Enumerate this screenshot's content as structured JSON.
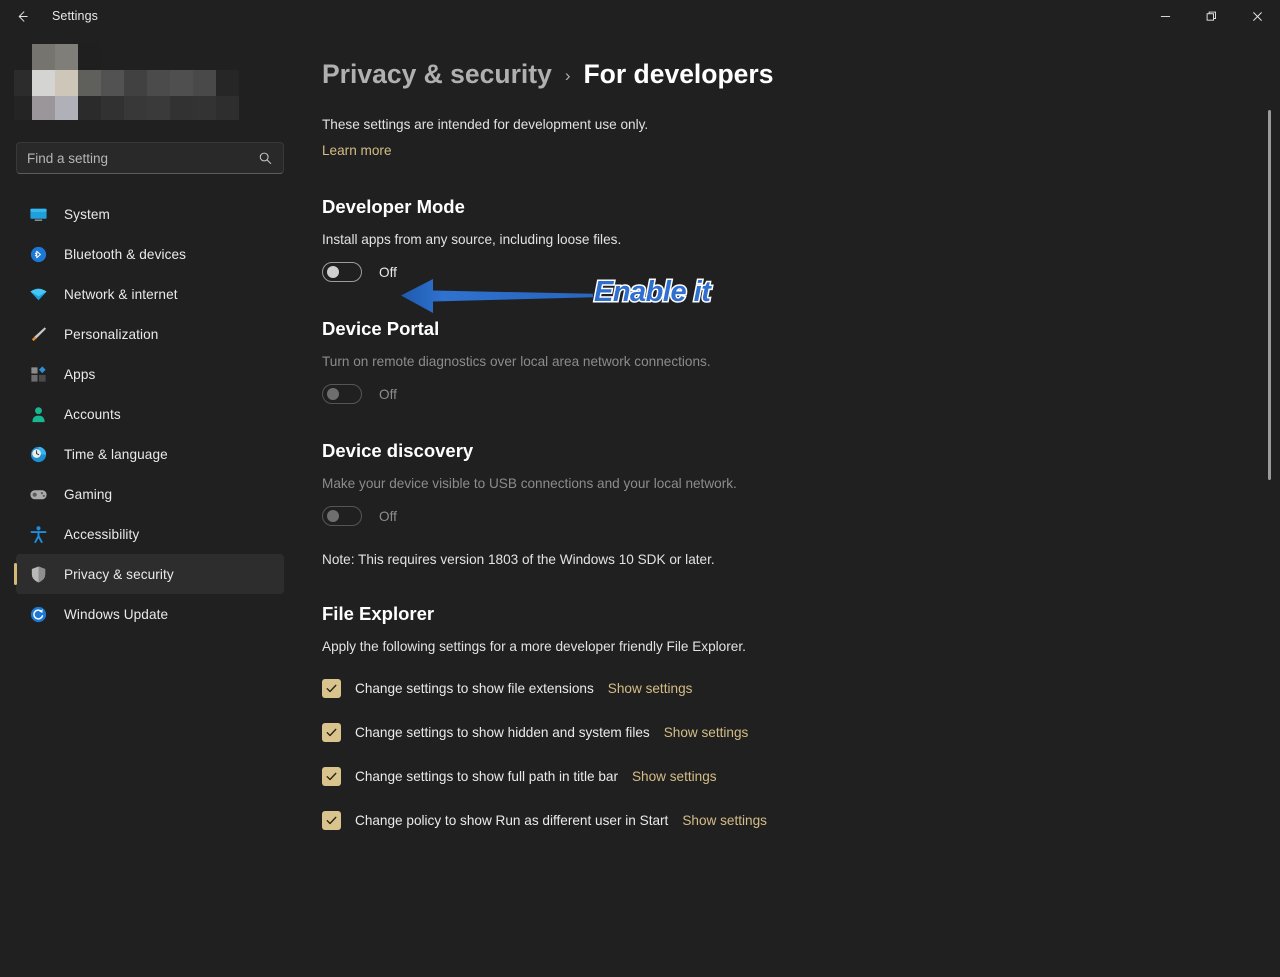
{
  "window": {
    "app_title": "Settings",
    "back_icon": "back-arrow-icon",
    "controls": {
      "minimize": "minimize-icon",
      "maximize": "restore-icon",
      "close": "close-icon"
    }
  },
  "sidebar": {
    "profile": {
      "redacted": true,
      "description": "pixelated user account name and email"
    },
    "search": {
      "placeholder": "Find a setting",
      "value": "",
      "icon": "search-icon"
    },
    "items": [
      {
        "label": "System",
        "icon": "monitor-icon",
        "selected": false
      },
      {
        "label": "Bluetooth & devices",
        "icon": "bluetooth-icon",
        "selected": false
      },
      {
        "label": "Network & internet",
        "icon": "wifi-icon",
        "selected": false
      },
      {
        "label": "Personalization",
        "icon": "paintbrush-icon",
        "selected": false
      },
      {
        "label": "Apps",
        "icon": "apps-icon",
        "selected": false
      },
      {
        "label": "Accounts",
        "icon": "person-icon",
        "selected": false
      },
      {
        "label": "Time & language",
        "icon": "clock-icon",
        "selected": false
      },
      {
        "label": "Gaming",
        "icon": "gamepad-icon",
        "selected": false
      },
      {
        "label": "Accessibility",
        "icon": "accessibility-icon",
        "selected": false
      },
      {
        "label": "Privacy & security",
        "icon": "shield-icon",
        "selected": true
      },
      {
        "label": "Windows Update",
        "icon": "update-icon",
        "selected": false
      }
    ]
  },
  "main": {
    "breadcrumb": {
      "parent": "Privacy & security",
      "separator": "›",
      "current": "For developers"
    },
    "intro": "These settings are intended for development use only.",
    "learn_more": "Learn more",
    "developer_mode": {
      "title": "Developer Mode",
      "description": "Install apps from any source, including loose files.",
      "toggle_state": "Off",
      "enabled": true
    },
    "device_portal": {
      "title": "Device Portal",
      "description": "Turn on remote diagnostics over local area network connections.",
      "toggle_state": "Off",
      "enabled": false
    },
    "device_discovery": {
      "title": "Device discovery",
      "description": "Make your device visible to USB connections and your local network.",
      "toggle_state": "Off",
      "enabled": false,
      "note": "Note: This requires version 1803 of the Windows 10 SDK or later."
    },
    "file_explorer": {
      "title": "File Explorer",
      "description": "Apply the following settings for a more developer friendly File Explorer.",
      "link_label": "Show settings",
      "rows": [
        {
          "label": "Change settings to show file extensions",
          "checked": true,
          "link": "Show settings"
        },
        {
          "label": "Change settings to show hidden and system files",
          "checked": true,
          "link": "Show settings"
        },
        {
          "label": "Change settings to show full path in title bar",
          "checked": true,
          "link": "Show settings"
        },
        {
          "label": "Change policy to show Run as different user in Start",
          "checked": true,
          "link": "Show settings"
        }
      ]
    }
  },
  "annotation": {
    "text": "Enable it",
    "arrow": "left-pointing-arrow",
    "arrow_color": "#2f6fd0",
    "text_color": "#2f6fd0",
    "text_outline_color": "#ffffff"
  },
  "colors": {
    "background": "#202020",
    "accent_gold": "#d4bd86",
    "selected_bg": "#2d2d2d",
    "annotation_blue": "#2f6fd0"
  }
}
